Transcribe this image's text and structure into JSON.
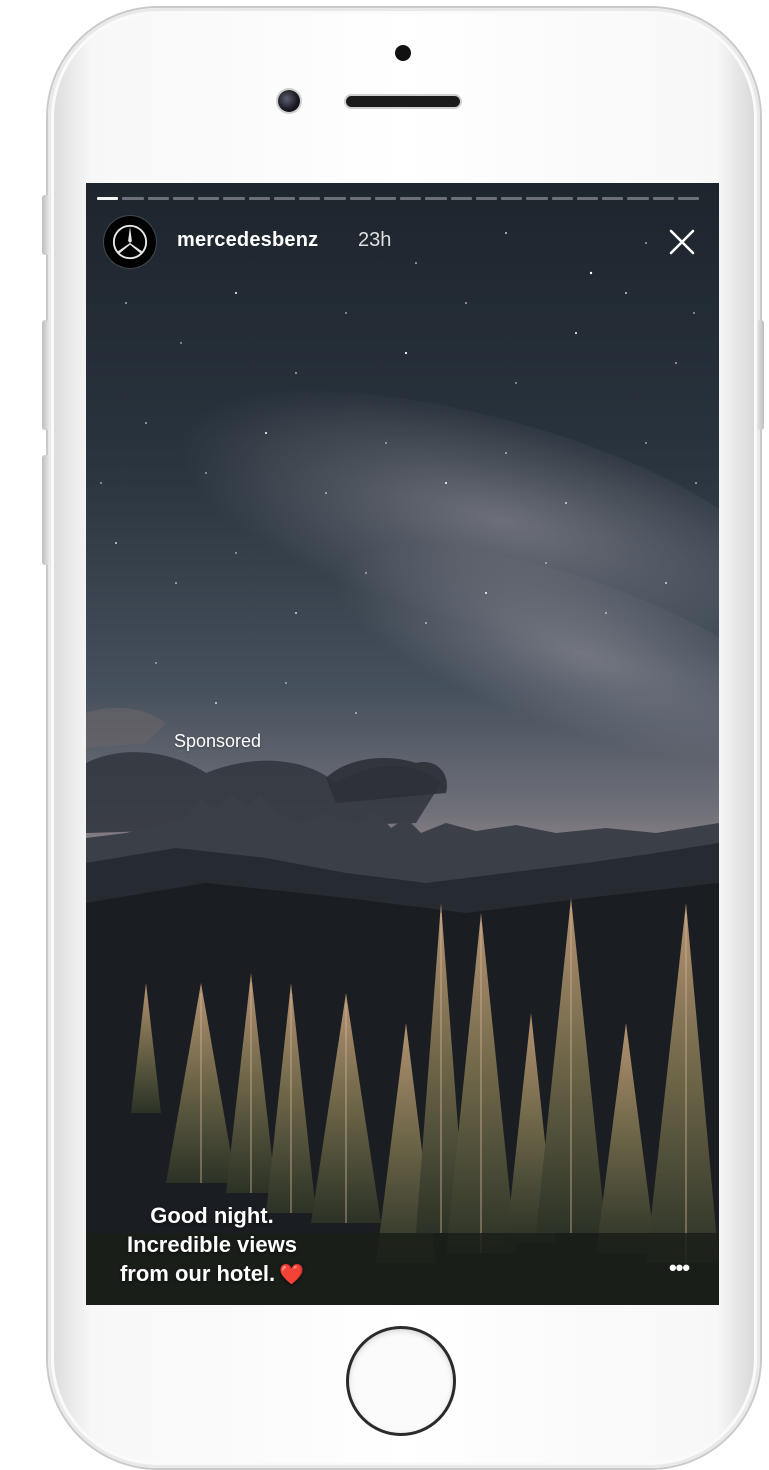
{
  "story": {
    "account": {
      "username": "mercedesbenz",
      "time_ago": "23h",
      "avatar_icon": "mercedes-star-logo"
    },
    "progress": {
      "segment_count": 24,
      "active_index": 0
    },
    "sponsored_label": "Sponsored",
    "caption": {
      "line1": "Good night.",
      "line2": "Incredible views",
      "line3": "from our hotel.",
      "emoji": "❤️"
    },
    "controls": {
      "close_icon": "close-icon",
      "more_icon": "more-options-icon",
      "more_text": "•••"
    }
  },
  "colors": {
    "sky_top": "#212a33",
    "sky_bottom": "#b99a9c",
    "forest": "#16181c",
    "heart": "#e8353a"
  }
}
